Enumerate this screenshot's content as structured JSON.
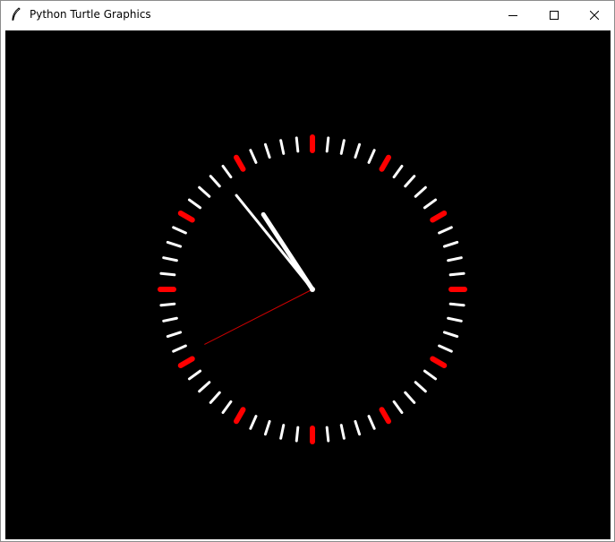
{
  "window": {
    "title": "Python Turtle Graphics",
    "icon": "feather-icon",
    "controls": {
      "minimize_icon": "minimize-icon",
      "maximize_icon": "maximize-icon",
      "close_icon": "close-icon"
    }
  },
  "canvas": {
    "background": "#000000"
  },
  "clock": {
    "tick_count": 60,
    "hour_marker_color": "#ff0000",
    "minute_tick_color": "#ffffff",
    "time": {
      "hours": 10,
      "minutes": 53.5,
      "seconds": 40.5
    },
    "hands": {
      "hour": {
        "color": "#ffffff"
      },
      "minute": {
        "color": "#ffffff"
      },
      "second": {
        "color": "#cc0000"
      }
    }
  }
}
